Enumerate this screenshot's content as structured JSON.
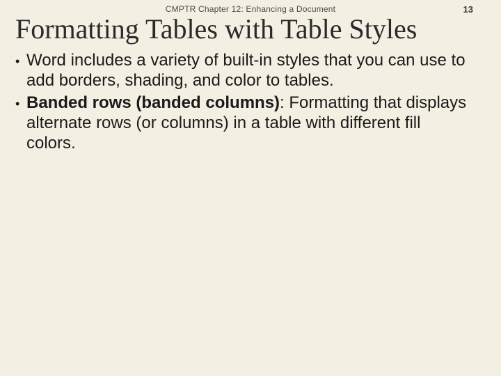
{
  "header": {
    "label": "CMPTR Chapter 12: Enhancing a Document",
    "page_number": "13"
  },
  "title": "Formatting Tables with Table Styles",
  "bullets": [
    {
      "lead": "",
      "bold": "",
      "rest": "Word includes a variety of built-in styles that you can use to add borders, shading, and color to tables."
    },
    {
      "lead": "",
      "bold": "Banded rows (banded columns)",
      "rest": ": Formatting that displays alternate rows (or columns) in a table with different fill colors."
    }
  ]
}
